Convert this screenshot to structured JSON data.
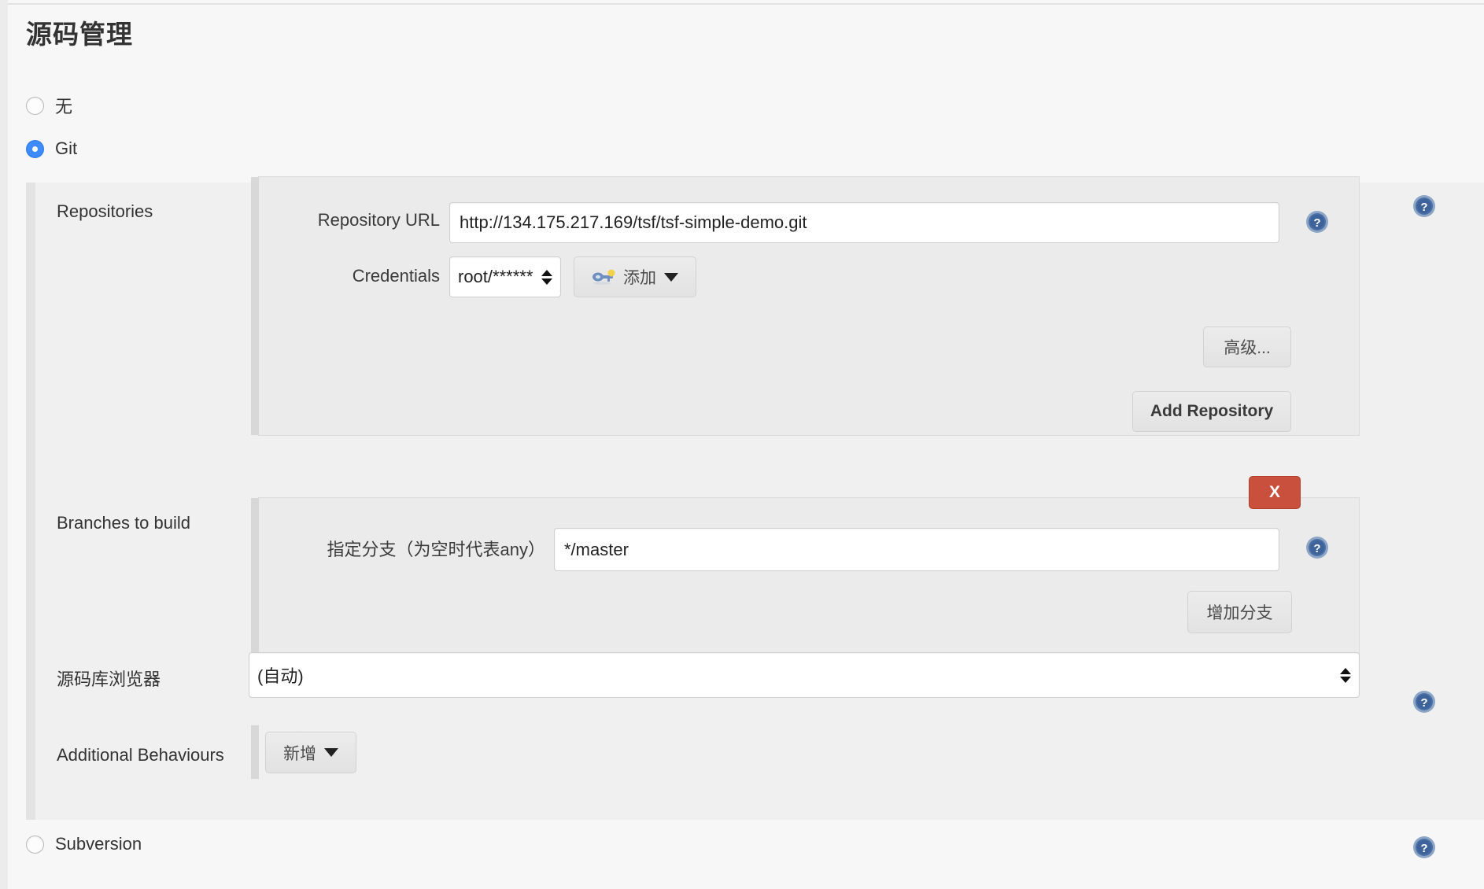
{
  "page": {
    "title": "源码管理"
  },
  "scm_options": [
    {
      "label": "无",
      "selected": false,
      "name": "none"
    },
    {
      "label": "Git",
      "selected": true,
      "name": "git"
    },
    {
      "label": "Subversion",
      "selected": false,
      "name": "subversion"
    }
  ],
  "git": {
    "repositories": {
      "label": "Repositories",
      "repository_url": {
        "label": "Repository URL",
        "value": "http://134.175.217.169/tsf/tsf-simple-demo.git",
        "placeholder": ""
      },
      "credentials": {
        "label": "Credentials",
        "value": "root/******",
        "add_button": "添加",
        "add_icon": "key-icon",
        "dropdown_icon": "caret-down-icon"
      },
      "advanced_button": "高级...",
      "add_repository_button": "Add Repository"
    },
    "branches": {
      "label": "Branches to build",
      "branch_specifier": {
        "label": "指定分支（为空时代表any）",
        "value": "*/master",
        "placeholder": ""
      },
      "delete_button": "X",
      "add_branch_button": "增加分支"
    },
    "repository_browser": {
      "label": "源码库浏览器",
      "value": "(自动)"
    },
    "additional_behaviours": {
      "label": "Additional Behaviours",
      "add_button": "新增",
      "dropdown_icon": "caret-down-icon"
    }
  },
  "help_icons": [
    {
      "name": "help-repositories",
      "title": "?"
    },
    {
      "name": "help-repository-url",
      "title": "?"
    },
    {
      "name": "help-branch-specifier",
      "title": "?"
    },
    {
      "name": "help-repository-browser",
      "title": "?"
    },
    {
      "name": "help-subversion",
      "title": "?"
    }
  ],
  "colors": {
    "accent": "#3d8bfd",
    "danger": "#c9503c",
    "help": "#4a6fa5",
    "panel_bg": "#ebebeb",
    "section_bg": "#f0f0f0",
    "page_bg": "#f7f7f7"
  }
}
